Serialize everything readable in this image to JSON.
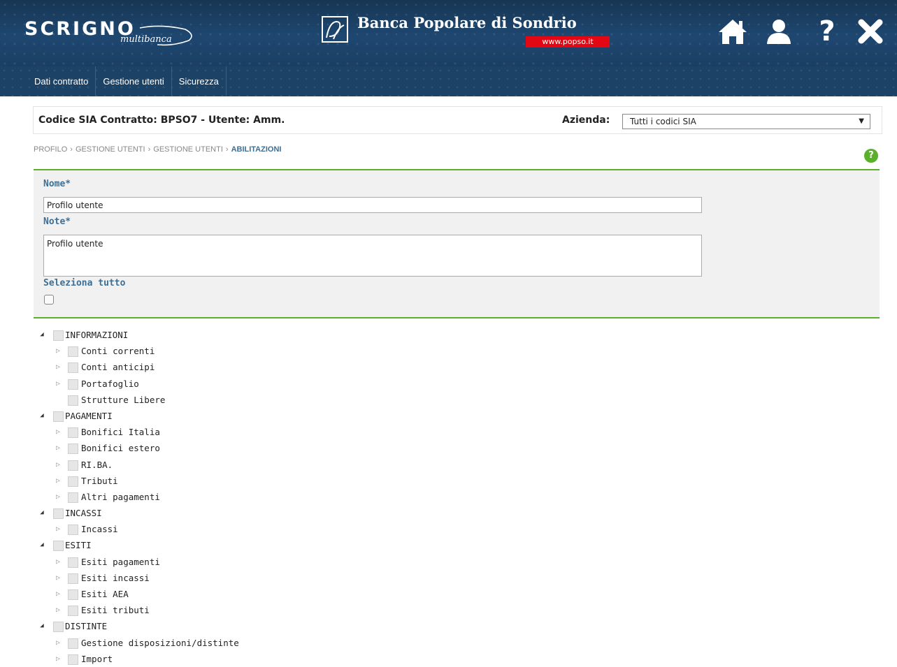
{
  "header": {
    "brand_name": "SCRIGNO",
    "brand_sub": "multibanca",
    "bank_name": "Banca Popolare di Sondrio",
    "bank_url": "www.popso.it",
    "icons": [
      "home-icon",
      "user-icon",
      "help-icon",
      "close-icon"
    ]
  },
  "nav": {
    "items": [
      {
        "label": "Dati contratto"
      },
      {
        "label": "Gestione utenti"
      },
      {
        "label": "Sicurezza"
      }
    ]
  },
  "page": {
    "title": "Codice SIA Contratto: BPSO7 - Utente: Amm.",
    "azienda_label": "Azienda:",
    "azienda_value": "Tutti i codici SIA",
    "breadcrumb": [
      "PROFILO",
      "GESTIONE UTENTI",
      "GESTIONE UTENTI",
      "ABILITAZIONI"
    ]
  },
  "form": {
    "nome_label": "Nome*",
    "nome_value": "Profilo utente",
    "note_label": "Note*",
    "note_value": "Profilo utente",
    "select_all_label": "Seleziona tutto"
  },
  "tree": [
    {
      "label": "INFORMAZIONI",
      "level": 0,
      "toggle": "expanded"
    },
    {
      "label": "Conti correnti",
      "level": 1,
      "toggle": "collapsed"
    },
    {
      "label": "Conti anticipi",
      "level": 1,
      "toggle": "collapsed"
    },
    {
      "label": "Portafoglio",
      "level": 1,
      "toggle": "collapsed"
    },
    {
      "label": "Strutture Libere",
      "level": 1,
      "toggle": "none"
    },
    {
      "label": "PAGAMENTI",
      "level": 0,
      "toggle": "expanded"
    },
    {
      "label": "Bonifici Italia",
      "level": 1,
      "toggle": "collapsed"
    },
    {
      "label": "Bonifici estero",
      "level": 1,
      "toggle": "collapsed"
    },
    {
      "label": "RI.BA.",
      "level": 1,
      "toggle": "collapsed"
    },
    {
      "label": "Tributi",
      "level": 1,
      "toggle": "collapsed"
    },
    {
      "label": "Altri pagamenti",
      "level": 1,
      "toggle": "collapsed"
    },
    {
      "label": "INCASSI",
      "level": 0,
      "toggle": "expanded"
    },
    {
      "label": "Incassi",
      "level": 1,
      "toggle": "collapsed"
    },
    {
      "label": "ESITI",
      "level": 0,
      "toggle": "expanded"
    },
    {
      "label": "Esiti pagamenti",
      "level": 1,
      "toggle": "collapsed"
    },
    {
      "label": "Esiti incassi",
      "level": 1,
      "toggle": "collapsed"
    },
    {
      "label": "Esiti AEA",
      "level": 1,
      "toggle": "collapsed"
    },
    {
      "label": "Esiti tributi",
      "level": 1,
      "toggle": "collapsed"
    },
    {
      "label": "DISTINTE",
      "level": 0,
      "toggle": "expanded"
    },
    {
      "label": "Gestione disposizioni/distinte",
      "level": 1,
      "toggle": "collapsed"
    },
    {
      "label": "Import",
      "level": 1,
      "toggle": "collapsed"
    }
  ],
  "colors": {
    "banner": "#1e4770",
    "accent_green": "#5ab02a",
    "label_blue": "#3d6f96",
    "url_red": "#e30613"
  }
}
